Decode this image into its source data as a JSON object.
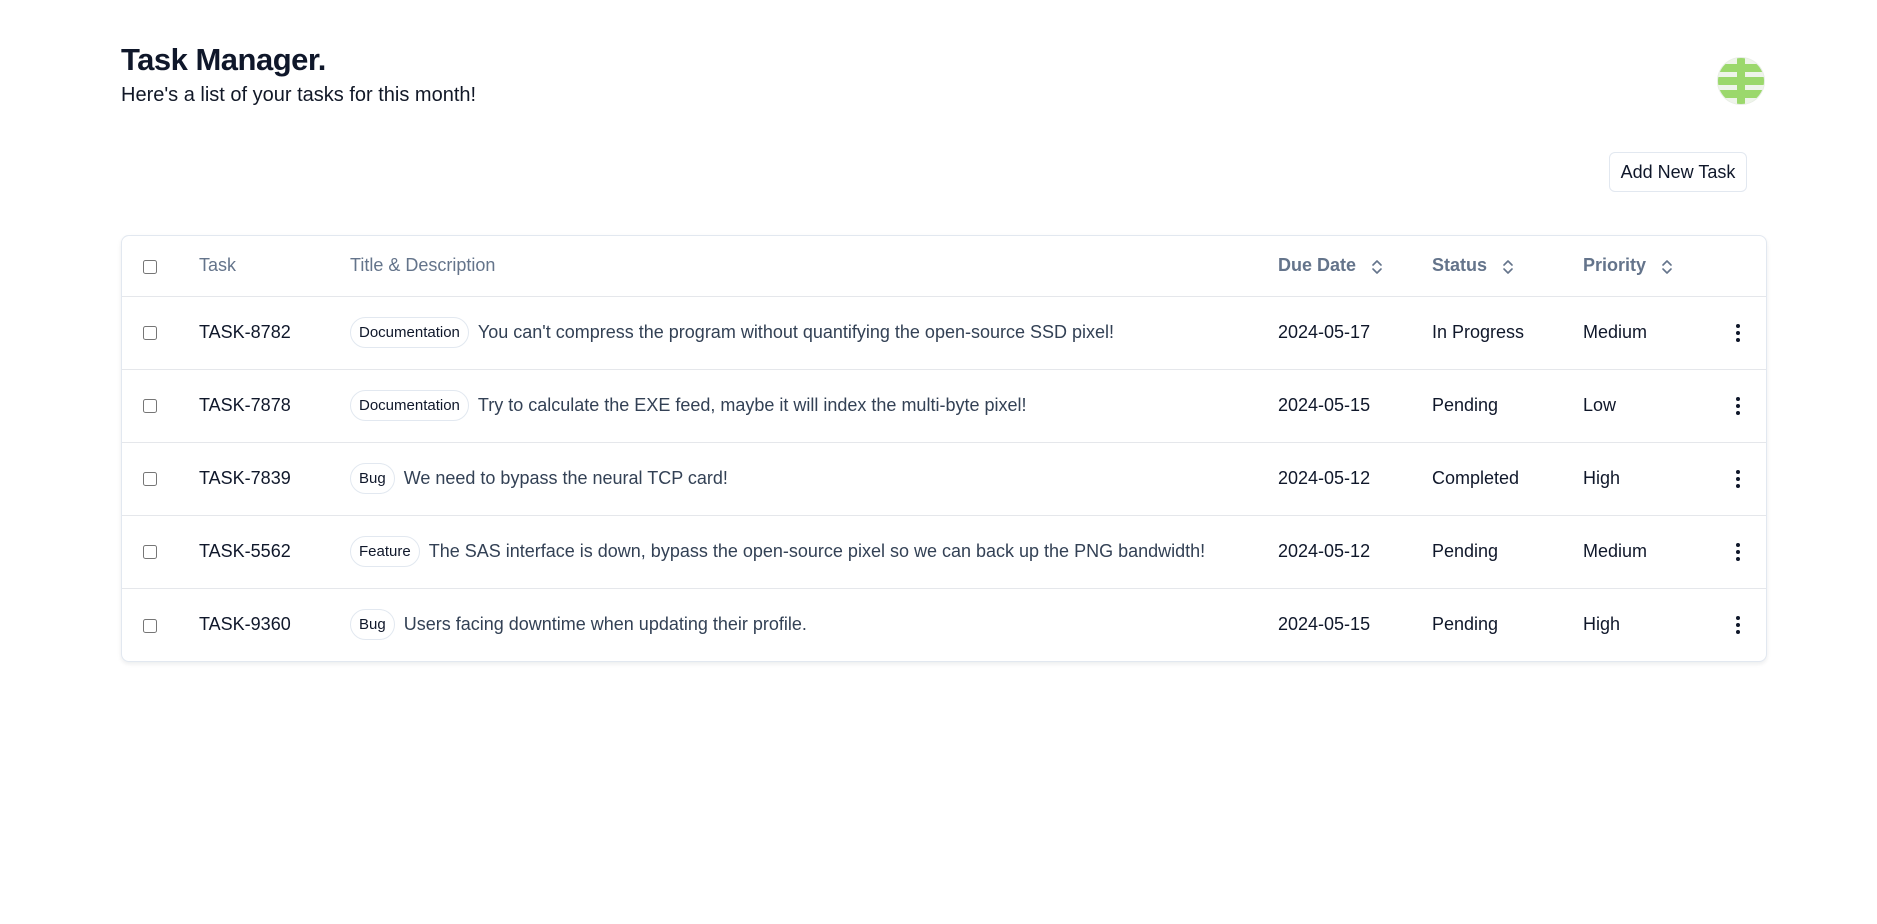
{
  "header": {
    "title": "Task Manager.",
    "subtitle": "Here's a list of your tasks for this month!"
  },
  "toolbar": {
    "add_label": "Add New Task"
  },
  "table": {
    "columns": {
      "task": "Task",
      "title": "Title & Description",
      "due": "Due Date",
      "status": "Status",
      "priority": "Priority"
    },
    "rows": [
      {
        "id": "TASK-8782",
        "label": "Documentation",
        "title": "You can't compress the program without quantifying the open-source SSD pixel!",
        "due": "2024-05-17",
        "status": "In Progress",
        "priority": "Medium"
      },
      {
        "id": "TASK-7878",
        "label": "Documentation",
        "title": "Try to calculate the EXE feed, maybe it will index the multi-byte pixel!",
        "due": "2024-05-15",
        "status": "Pending",
        "priority": "Low"
      },
      {
        "id": "TASK-7839",
        "label": "Bug",
        "title": "We need to bypass the neural TCP card!",
        "due": "2024-05-12",
        "status": "Completed",
        "priority": "High"
      },
      {
        "id": "TASK-5562",
        "label": "Feature",
        "title": "The SAS interface is down, bypass the open-source pixel so we can back up the PNG bandwidth!",
        "due": "2024-05-12",
        "status": "Pending",
        "priority": "Medium"
      },
      {
        "id": "TASK-9360",
        "label": "Bug",
        "title": "Users facing downtime when updating their profile.",
        "due": "2024-05-15",
        "status": "Pending",
        "priority": "High"
      }
    ]
  },
  "colors": {
    "avatar_green": "#9bd86c",
    "border": "#e2e8f0",
    "muted_text": "#64748b"
  },
  "icons": {
    "avatar": "avatar-pattern-icon",
    "sort": "chevron-up-down-icon",
    "row_menu": "vertical-ellipsis-icon"
  }
}
